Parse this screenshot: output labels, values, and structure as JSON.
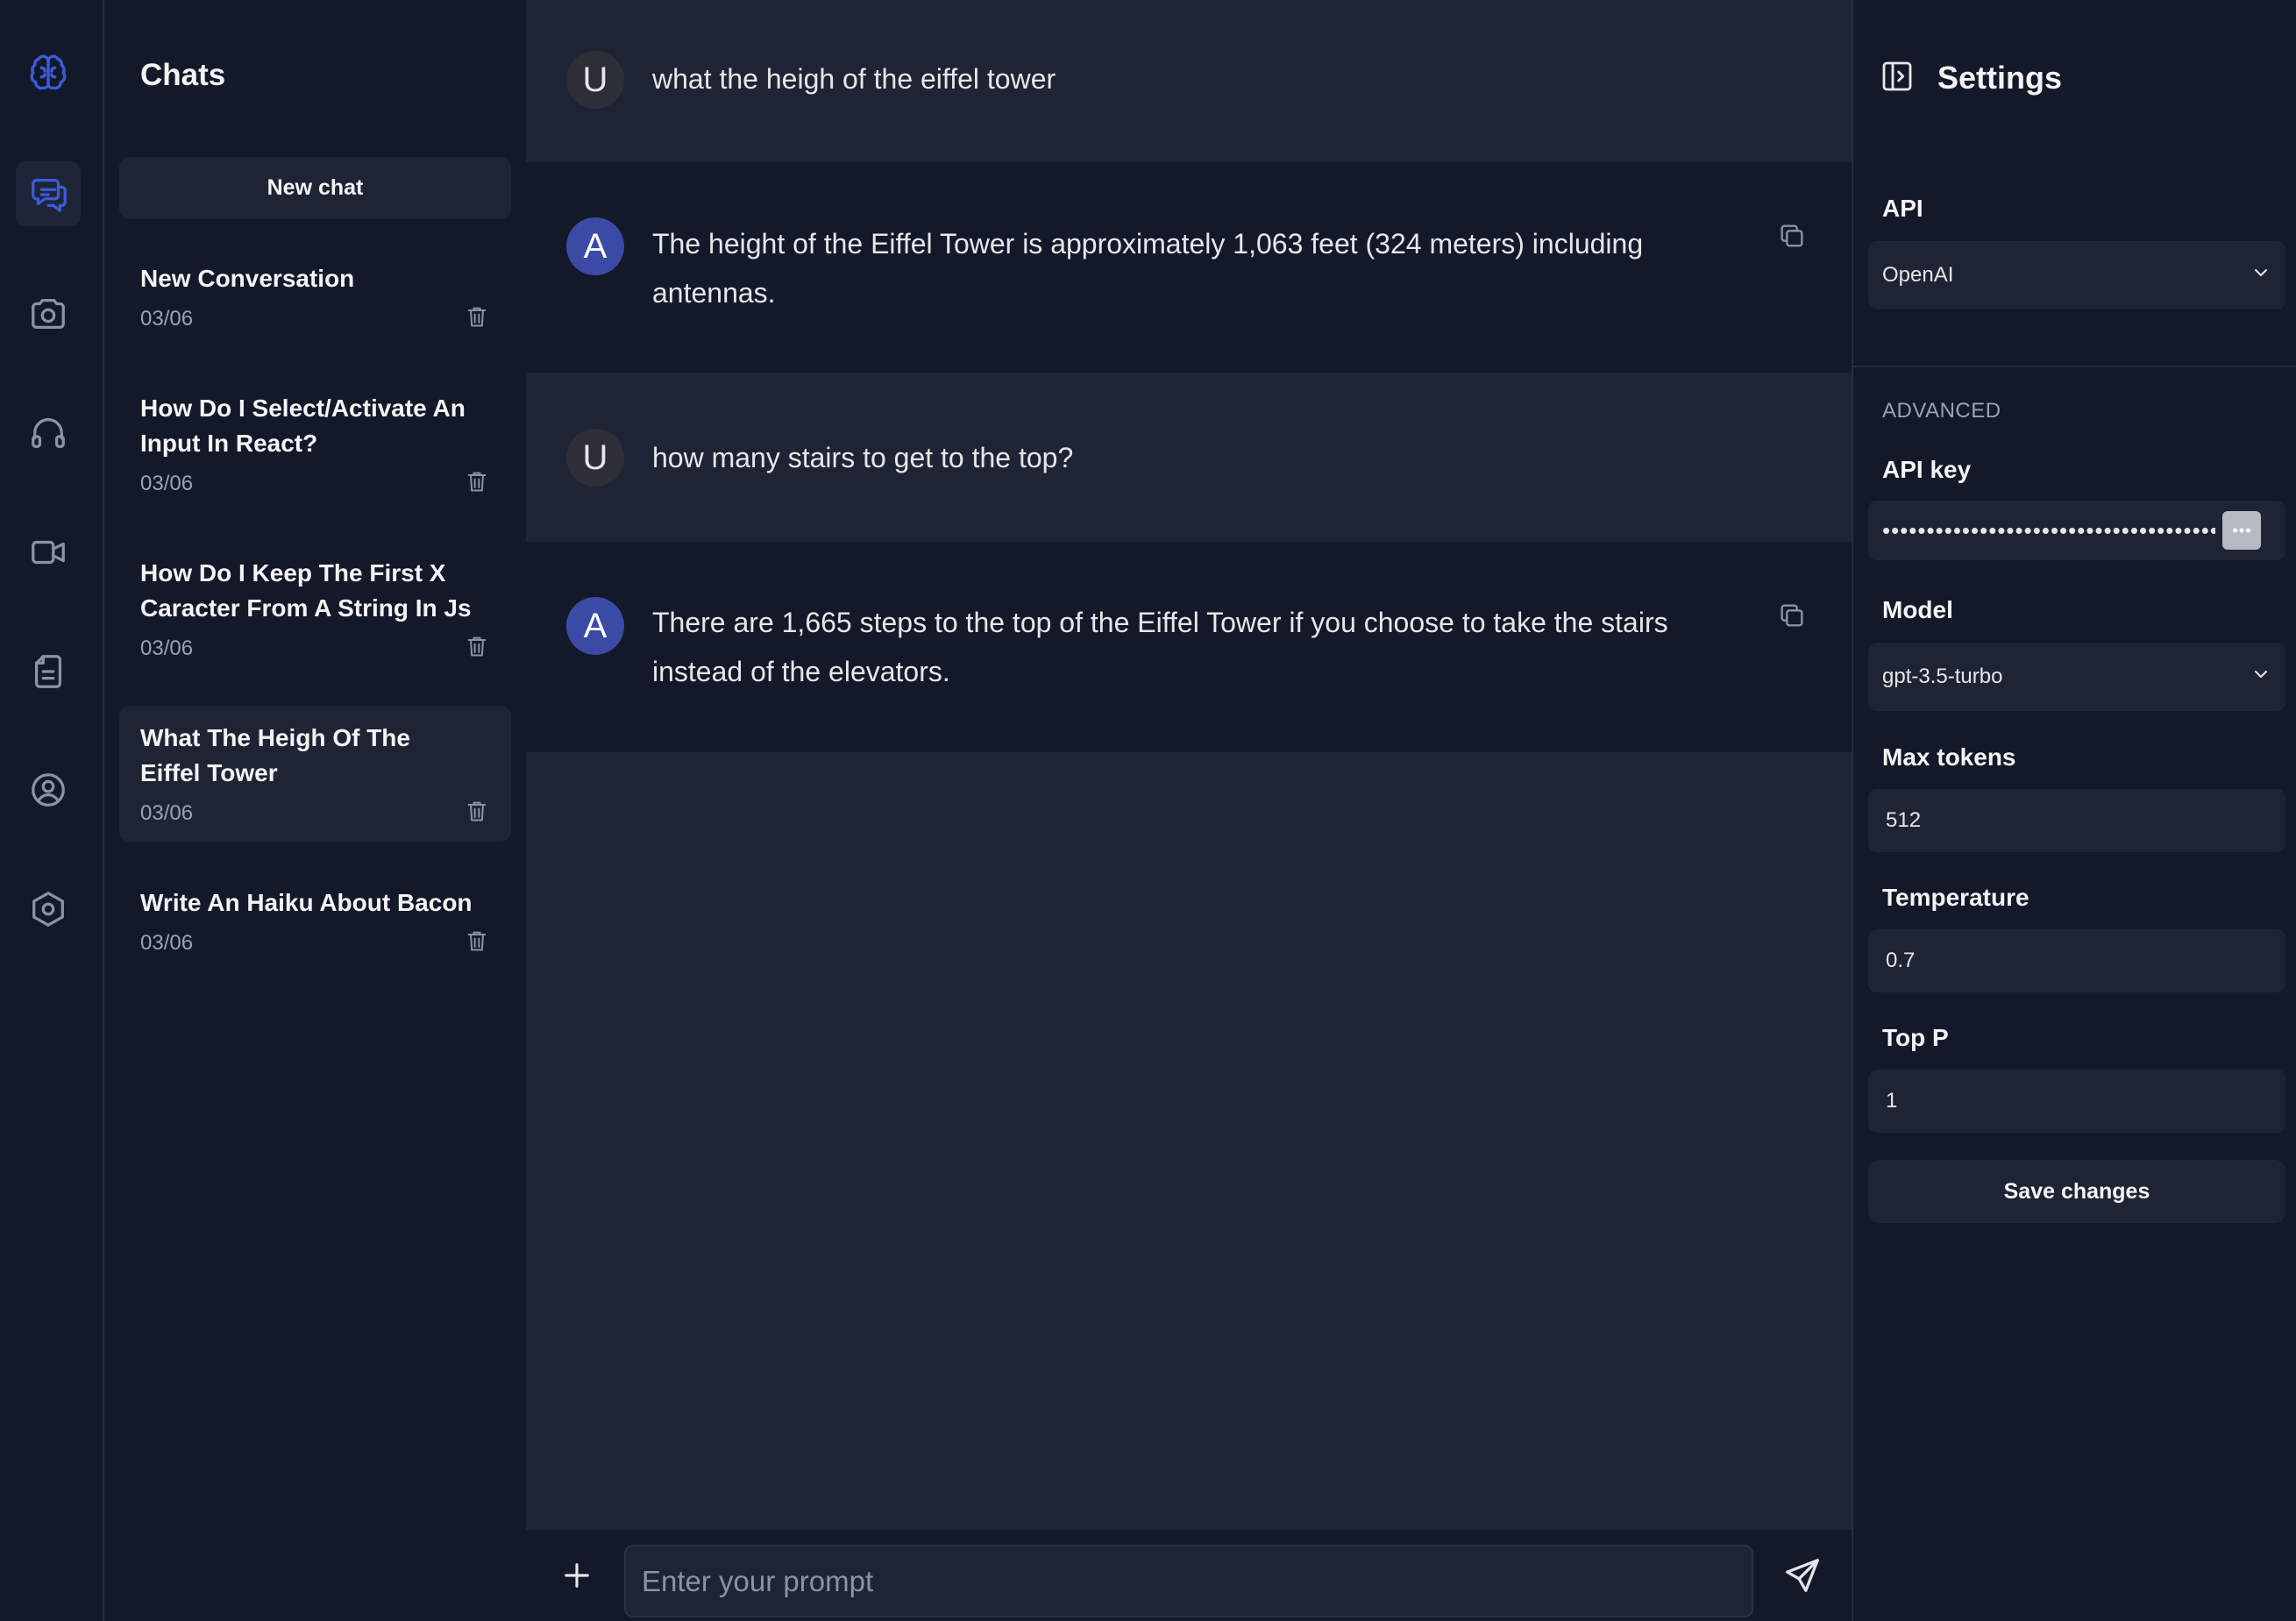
{
  "sidebar": {
    "title": "Chats",
    "new_chat_label": "New chat",
    "chats": [
      {
        "name": "New Conversation",
        "date": "03/06"
      },
      {
        "name": "How Do I Select/Activate An Input In React?",
        "date": "03/06"
      },
      {
        "name": "How Do I Keep The First X Caracter From A String In Js",
        "date": "03/06"
      },
      {
        "name": "What The Heigh Of The Eiffel Tower",
        "date": "03/06",
        "active": true
      },
      {
        "name": "Write An Haiku About Bacon",
        "date": "03/06"
      }
    ]
  },
  "rail": {
    "items": [
      "brain-logo-icon",
      "chat-icon",
      "camera-icon",
      "headphones-icon",
      "video-icon",
      "document-icon",
      "user-circle-icon",
      "settings-hexagon-icon"
    ],
    "active": "chat-icon"
  },
  "messages": [
    {
      "role": "user",
      "avatar": "U",
      "text": "what the heigh of the eiffel tower"
    },
    {
      "role": "assistant",
      "avatar": "A",
      "text": "The height of the Eiffel Tower is approximately 1,063 feet (324 meters) including antennas."
    },
    {
      "role": "user",
      "avatar": "U",
      "text": "how many stairs to get to the top?"
    },
    {
      "role": "assistant",
      "avatar": "A",
      "text": "There are 1,665 steps to the top of the Eiffel Tower if you choose to take the stairs instead of the elevators."
    }
  ],
  "composer": {
    "placeholder": "Enter your prompt"
  },
  "settings": {
    "title": "Settings",
    "api_label": "API",
    "api_value": "OpenAI",
    "advanced_label": "ADVANCED",
    "api_key_label": "API key",
    "api_key_value": "••••••••••••••••••••••••••••••••••••••••••••••••••••",
    "model_label": "Model",
    "model_value": "gpt-3.5-turbo",
    "max_tokens_label": "Max tokens",
    "max_tokens_value": "512",
    "temperature_label": "Temperature",
    "temperature_value": "0.7",
    "top_p_label": "Top P",
    "top_p_value": "1",
    "save_label": "Save changes"
  },
  "colors": {
    "accent": "#3b5bdb",
    "panel": "#131929",
    "surface": "#1e2433"
  }
}
